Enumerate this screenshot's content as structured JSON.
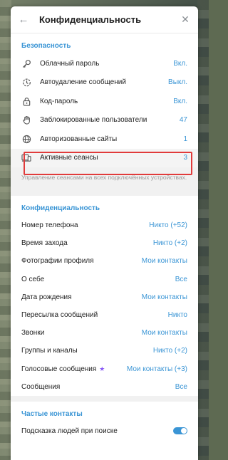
{
  "header": {
    "title": "Конфиденциальность"
  },
  "security": {
    "title": "Безопасность",
    "items": [
      {
        "label": "Облачный пароль",
        "value": "Вкл."
      },
      {
        "label": "Автоудаление сообщений",
        "value": "Выкл."
      },
      {
        "label": "Код-пароль",
        "value": "Вкл."
      },
      {
        "label": "Заблокированные пользователи",
        "value": "47"
      },
      {
        "label": "Авторизованные сайты",
        "value": "1"
      },
      {
        "label": "Активные сеансы",
        "value": "3"
      }
    ],
    "hint": "Управление сеансами на всех подключённых устройствах."
  },
  "privacy": {
    "title": "Конфиденциальность",
    "items": [
      {
        "label": "Номер телефона",
        "value": "Никто (+52)"
      },
      {
        "label": "Время захода",
        "value": "Никто (+2)"
      },
      {
        "label": "Фотографии профиля",
        "value": "Мои контакты"
      },
      {
        "label": "О себе",
        "value": "Все"
      },
      {
        "label": "Дата рождения",
        "value": "Мои контакты"
      },
      {
        "label": "Пересылка сообщений",
        "value": "Никто"
      },
      {
        "label": "Звонки",
        "value": "Мои контакты"
      },
      {
        "label": "Группы и каналы",
        "value": "Никто (+2)"
      },
      {
        "label": "Голосовые сообщения",
        "value": "Мои контакты (+3)"
      },
      {
        "label": "Сообщения",
        "value": "Все"
      }
    ]
  },
  "contacts": {
    "title": "Частые контакты",
    "items": [
      {
        "label": "Подсказка людей при поиске",
        "enabled": true
      }
    ]
  },
  "colors": {
    "accent": "#3a95d5",
    "highlight": "#e13b3b",
    "premium_star": "#8b5cf6"
  }
}
